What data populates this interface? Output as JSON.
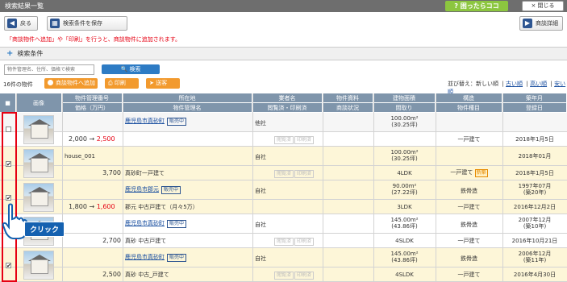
{
  "window": {
    "title": "検索結果一覧"
  },
  "header": {
    "help_label": "困ったらココ",
    "close_label": "閉じる",
    "close_icon": "×"
  },
  "toolbar": {
    "back_label": "戻る",
    "save_conditions_label": "検索条件を保存",
    "details_label": "商談詳細"
  },
  "notice": "「商談物件へ追加」や「印刷」を行うと、商談物件に追加されます。",
  "search": {
    "section_label": "検索条件",
    "placeholder": "物件管理名、住所、価格で検索",
    "button_label": "検索"
  },
  "results": {
    "count_label": "16件の物件",
    "add_label": "商談物件へ追加",
    "print_label": "印刷",
    "send_label": "送客",
    "sort_label": "並び替え：",
    "sort_current": "新しい順",
    "sort_options": [
      "古い順",
      "高い順",
      "安い順"
    ]
  },
  "table": {
    "headers": {
      "check": "■",
      "photo": "画像",
      "mgmt_no": "物件管理番号",
      "price": "価格（万円）",
      "location": "所在地",
      "mgmt_name": "物件管理名",
      "owner": "業者名",
      "docs": "閲覧済・印刷済",
      "material": "物件資料",
      "status": "商談状況",
      "area": "建物面積",
      "layout": "間取り",
      "structure": "構造",
      "type": "物件種目",
      "built": "築年月",
      "registered": "登録日"
    },
    "rows": [
      {
        "checked": "",
        "mgmt_no": "",
        "price_old": "2,000",
        "arrow": "→",
        "price_new": "2,500",
        "location": "鹿児島市真砂町",
        "status_badge": "販売中",
        "name": "",
        "owner": "他社",
        "docs_viewed": "閲覧済",
        "docs_printed": "印刷済",
        "area_main": "100.00m²",
        "area_sub": "(30.25坪)",
        "layout": "",
        "structure": "",
        "type": "一戸建て",
        "new_badge": "",
        "built": "",
        "registered": "2018年1月5日"
      },
      {
        "checked": "✔",
        "mgmt_no": "house_001",
        "price_old": "",
        "arrow": "",
        "price_new": "",
        "price": "3,700",
        "location": "",
        "status_badge": "",
        "name": "真砂町一戸建て",
        "owner": "自社",
        "docs_viewed": "閲覧済",
        "docs_printed": "印刷済",
        "area_main": "100.00m²",
        "area_sub": "(30.25坪)",
        "layout": "4LDK",
        "structure": "",
        "type": "一戸建て",
        "new_badge": "新築",
        "built": "2018年01月",
        "registered": "2018年1月5日"
      },
      {
        "checked": "✔",
        "mgmt_no": "",
        "price_old": "1,800",
        "arrow": "→",
        "price_new": "1,600",
        "location": "鹿児島市郡元",
        "status_badge": "販売中",
        "name": "郡元 中古戸建て（月々5万）",
        "owner": "自社",
        "docs_viewed": "",
        "docs_printed": "",
        "area_main": "90.00m²",
        "area_sub": "(27.22坪)",
        "layout": "3LDK",
        "structure": "鉄骨造",
        "type": "一戸建て",
        "new_badge": "",
        "built": "1997年07月",
        "built_sub": "(築20年)",
        "registered": "2016年12月2日"
      },
      {
        "checked": "",
        "mgmt_no": "",
        "price": "2,700",
        "location": "鹿児島市真砂町",
        "status_badge": "販売中",
        "name": "真砂 中古戸建て",
        "owner": "自社",
        "docs_viewed": "閲覧済",
        "docs_printed": "印刷済",
        "area_main": "145.00m²",
        "area_sub": "(43.86坪)",
        "layout": "4SLDK",
        "structure": "鉄骨造",
        "type": "一戸建て",
        "built": "2007年12月",
        "built_sub": "(築10年)",
        "registered": "2016年10月21日"
      },
      {
        "checked": "✔",
        "mgmt_no": "",
        "price": "2,500",
        "location": "鹿児島市真砂町",
        "status_badge": "販売中",
        "name": "真砂 中古_戸建て",
        "owner": "自社",
        "docs_viewed": "閲覧済",
        "docs_printed": "印刷済",
        "area_main": "145.00m²",
        "area_sub": "(43.86坪)",
        "layout": "4SLDK",
        "structure": "鉄骨造",
        "type": "一戸建て",
        "built": "2006年12月",
        "built_sub": "(築11年)",
        "registered": "2016年4月30日"
      }
    ]
  },
  "overlay": {
    "click_label": "クリック"
  }
}
